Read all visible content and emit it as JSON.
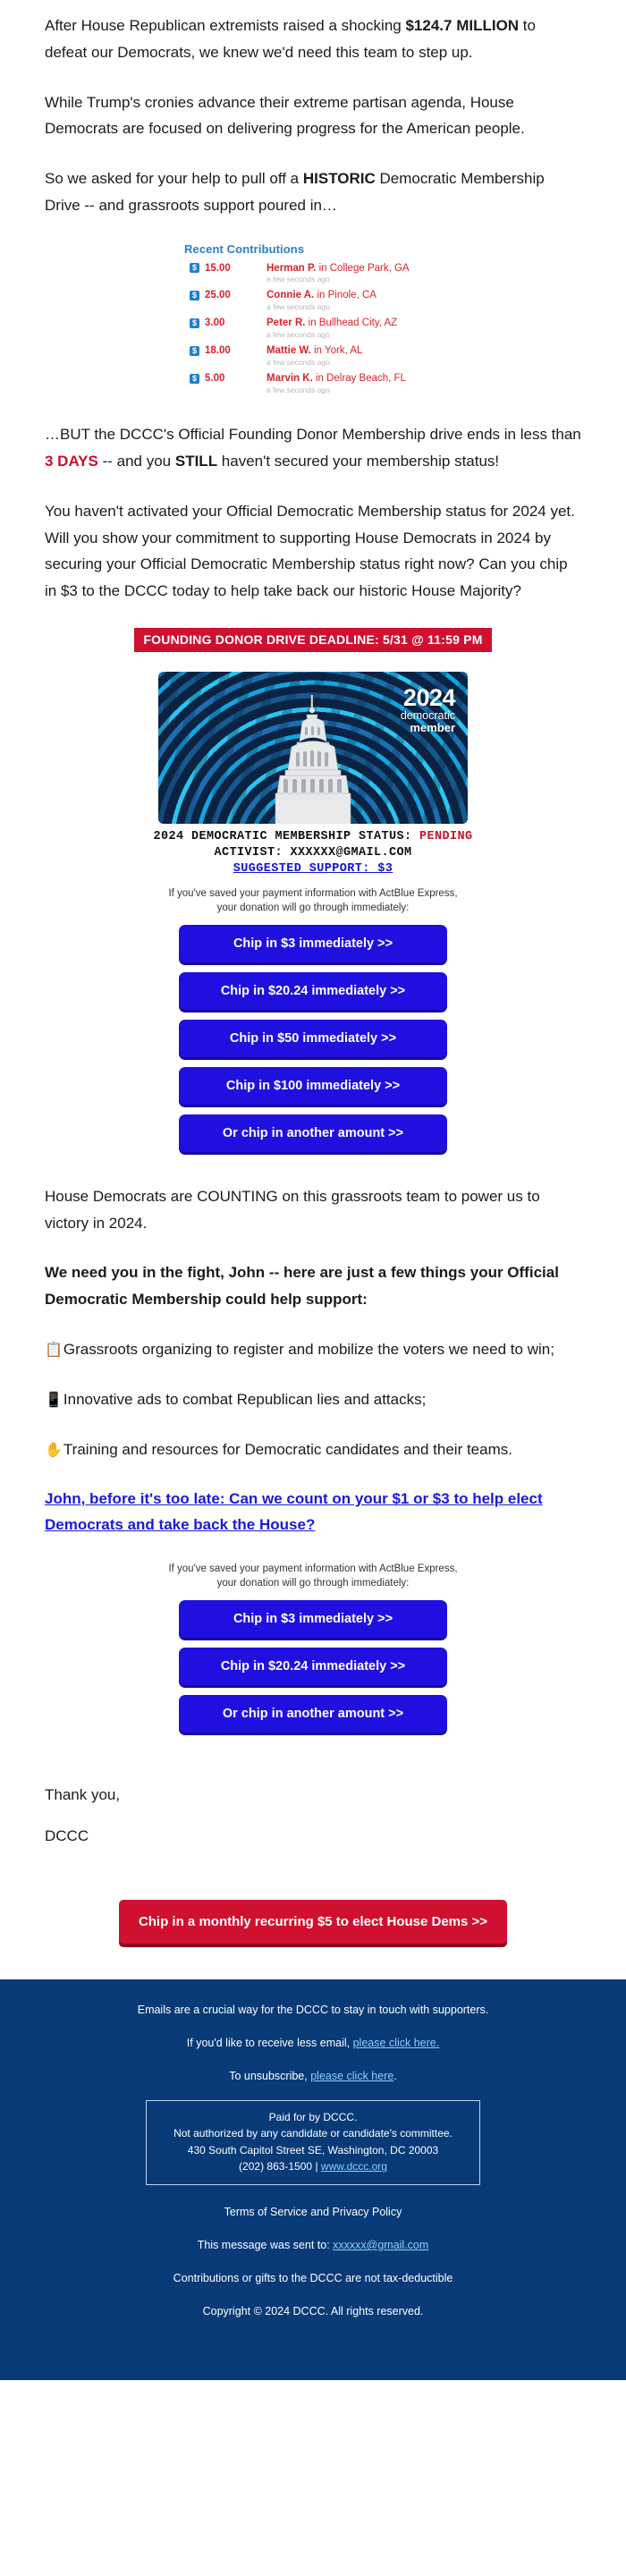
{
  "intro": {
    "p1_a": "After House Republican extremists raised a shocking ",
    "p1_b": "$124.7 MILLION",
    "p1_c": " to defeat our Democrats, we knew we'd need this team to step up.",
    "p2": "While Trump's cronies advance their extreme partisan agenda, House Democrats are focused on delivering progress for the American people.",
    "p3_a": "So we asked for your help to pull off a ",
    "p3_b": "HISTORIC",
    "p3_c": " Democratic Membership Drive -- and grassroots support poured in…"
  },
  "contributions": {
    "title": "Recent Contributions",
    "currency_icon": "dollar-icon",
    "time_label": "a few seconds ago",
    "rows": [
      {
        "amount": "15.00",
        "name": "Herman P.",
        "location": " in College Park, GA",
        "time": "a few seconds ago"
      },
      {
        "amount": "25.00",
        "name": "Connie A.",
        "location": " in Pinole, CA",
        "time": "a few seconds ago"
      },
      {
        "amount": "3.00",
        "name": "Peter R.",
        "location": " in Bullhead City, AZ",
        "time": "a few seconds ago"
      },
      {
        "amount": "18.00",
        "name": "Mattie W.",
        "location": " in York, AL",
        "time": "a few seconds ago"
      },
      {
        "amount": "5.00",
        "name": "Marvin K.",
        "location": "  in Delray Beach, FL",
        "time": "a few seconds ago"
      }
    ]
  },
  "urgency": {
    "p4_a": "…BUT the DCCC's Official Founding Donor Membership drive ends in less than ",
    "p4_b": "3 DAYS",
    "p4_c": " -- and you ",
    "p4_d": "STILL",
    "p4_e": " haven't secured your membership status!",
    "p5": "You haven't activated your Official Democratic Membership status for 2024 yet. Will you show your commitment to supporting House Democrats in 2024 by securing your Official Democratic Membership status right now? Can you chip in $3 to the DCCC today to help take back our historic House Majority?"
  },
  "deadline_banner": "FOUNDING DONOR DRIVE DEADLINE: 5/31 @ 11:59 PM",
  "card": {
    "year": "2024",
    "line1": "democratic",
    "line2": "member"
  },
  "status": {
    "label": "2024 DEMOCRATIC MEMBERSHIP STATUS:",
    "value": "PENDING",
    "activist_label": "ACTIVIST:",
    "activist_value": "XXXXXX@GMAIL.COM",
    "support": "SUGGESTED SUPPORT: $3"
  },
  "express_note": {
    "line1": "If you've saved your payment information with ActBlue Express,",
    "line2": "your donation will go through immediately:"
  },
  "buttons_primary": [
    "Chip in $3 immediately >>",
    "Chip in $20.24 immediately >>",
    "Chip in $50 immediately >>",
    "Chip in $100 immediately >>",
    "Or chip in another amount >>"
  ],
  "mid": {
    "p6": "House Democrats are COUNTING on this grassroots team to power us to victory in 2024.",
    "p7": "We need you in the fight, John -- here are just a few things your Official Democratic Membership could help support:",
    "bullets": [
      {
        "icon": "📋",
        "icon_name": "clipboard-icon",
        "text": "Grassroots organizing to register and mobilize the voters we need to win;"
      },
      {
        "icon": "📱",
        "icon_name": "mobile-phone-icon",
        "text": "Innovative ads to combat Republican lies and attacks;"
      },
      {
        "icon": "✋",
        "icon_name": "raised-hand-icon",
        "text": "Training and resources for Democratic candidates and their teams."
      }
    ],
    "big_link": "John, before it's too late: Can we count on your $1 or $3 to help elect Democrats and take back the House?"
  },
  "buttons_secondary": [
    "Chip in $3 immediately >>",
    "Chip in $20.24 immediately >>",
    "Or chip in another amount >>"
  ],
  "signoff": {
    "thanks": "Thank you,",
    "name": "DCCC"
  },
  "recurring_button": "Chip in a monthly recurring $5 to elect House Dems >>",
  "footer": {
    "line1": "Emails are a crucial way for the DCCC to stay in touch with supporters.",
    "line2_pre": "If you'd like to receive less email, ",
    "line2_link": "please click here.",
    "line3_pre": "To unsubscribe, ",
    "line3_link": "please click here",
    "line3_post": ".",
    "disclaimer_1": "Paid for by DCCC.",
    "disclaimer_2": "Not authorized by any candidate or candidate's committee.",
    "disclaimer_3": "430 South Capitol Street SE, Washington, DC 20003",
    "disclaimer_phone": "(202) 863-1500 | ",
    "disclaimer_url": "www.dccc.org",
    "terms": "Terms of Service and Privacy Policy",
    "sent_pre": "This message was sent to: ",
    "sent_email": "xxxxxx@gmail.com",
    "tax": "Contributions or gifts to the DCCC are not tax-deductible",
    "copyright": "Copyright © 2024 DCCC. All rights reserved."
  },
  "colors": {
    "accent_red": "#d0102f",
    "accent_blue": "#1f10e0",
    "footer_navy": "#073a77",
    "link_blue": "#1a1ad6"
  }
}
